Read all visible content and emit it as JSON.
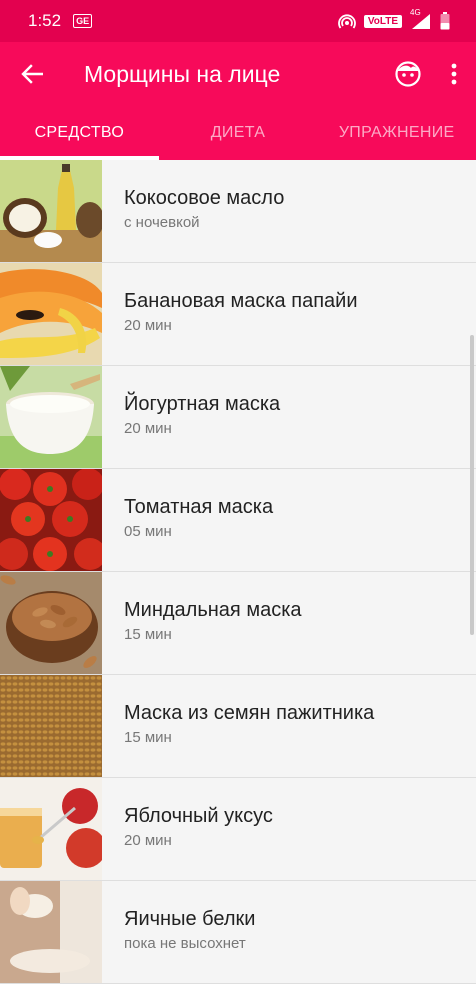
{
  "status": {
    "time": "1:52",
    "badge": "GE",
    "volte": "VoLTE",
    "network": "4G"
  },
  "appbar": {
    "title": "Морщины на лице"
  },
  "tabs": [
    {
      "label": "СРЕДСТВО",
      "active": true
    },
    {
      "label": "ДИЕТА",
      "active": false
    },
    {
      "label": "УПРАЖНЕНИЕ",
      "active": false
    }
  ],
  "items": [
    {
      "name": "Кокосовое масло",
      "sub": "с ночевкой",
      "image": "coconut-oil"
    },
    {
      "name": "Банановая маска папайи",
      "sub": "20 мин",
      "image": "papaya-banana"
    },
    {
      "name": "Йогуртная маска",
      "sub": "20 мин",
      "image": "yogurt"
    },
    {
      "name": "Томатная маска",
      "sub": "05 мин",
      "image": "tomatoes"
    },
    {
      "name": "Миндальная маска",
      "sub": "15 мин",
      "image": "almonds"
    },
    {
      "name": "Маска из семян пажитника",
      "sub": "15 мин",
      "image": "fenugreek-seeds"
    },
    {
      "name": "Яблочный уксус",
      "sub": "20 мин",
      "image": "apple-vinegar"
    },
    {
      "name": "Яичные белки",
      "sub": "пока не высохнет",
      "image": "egg-whites"
    }
  ],
  "colors": {
    "statusbar": "#e3014f",
    "appbar": "#f70a5a",
    "background": "#f5f5f5"
  }
}
